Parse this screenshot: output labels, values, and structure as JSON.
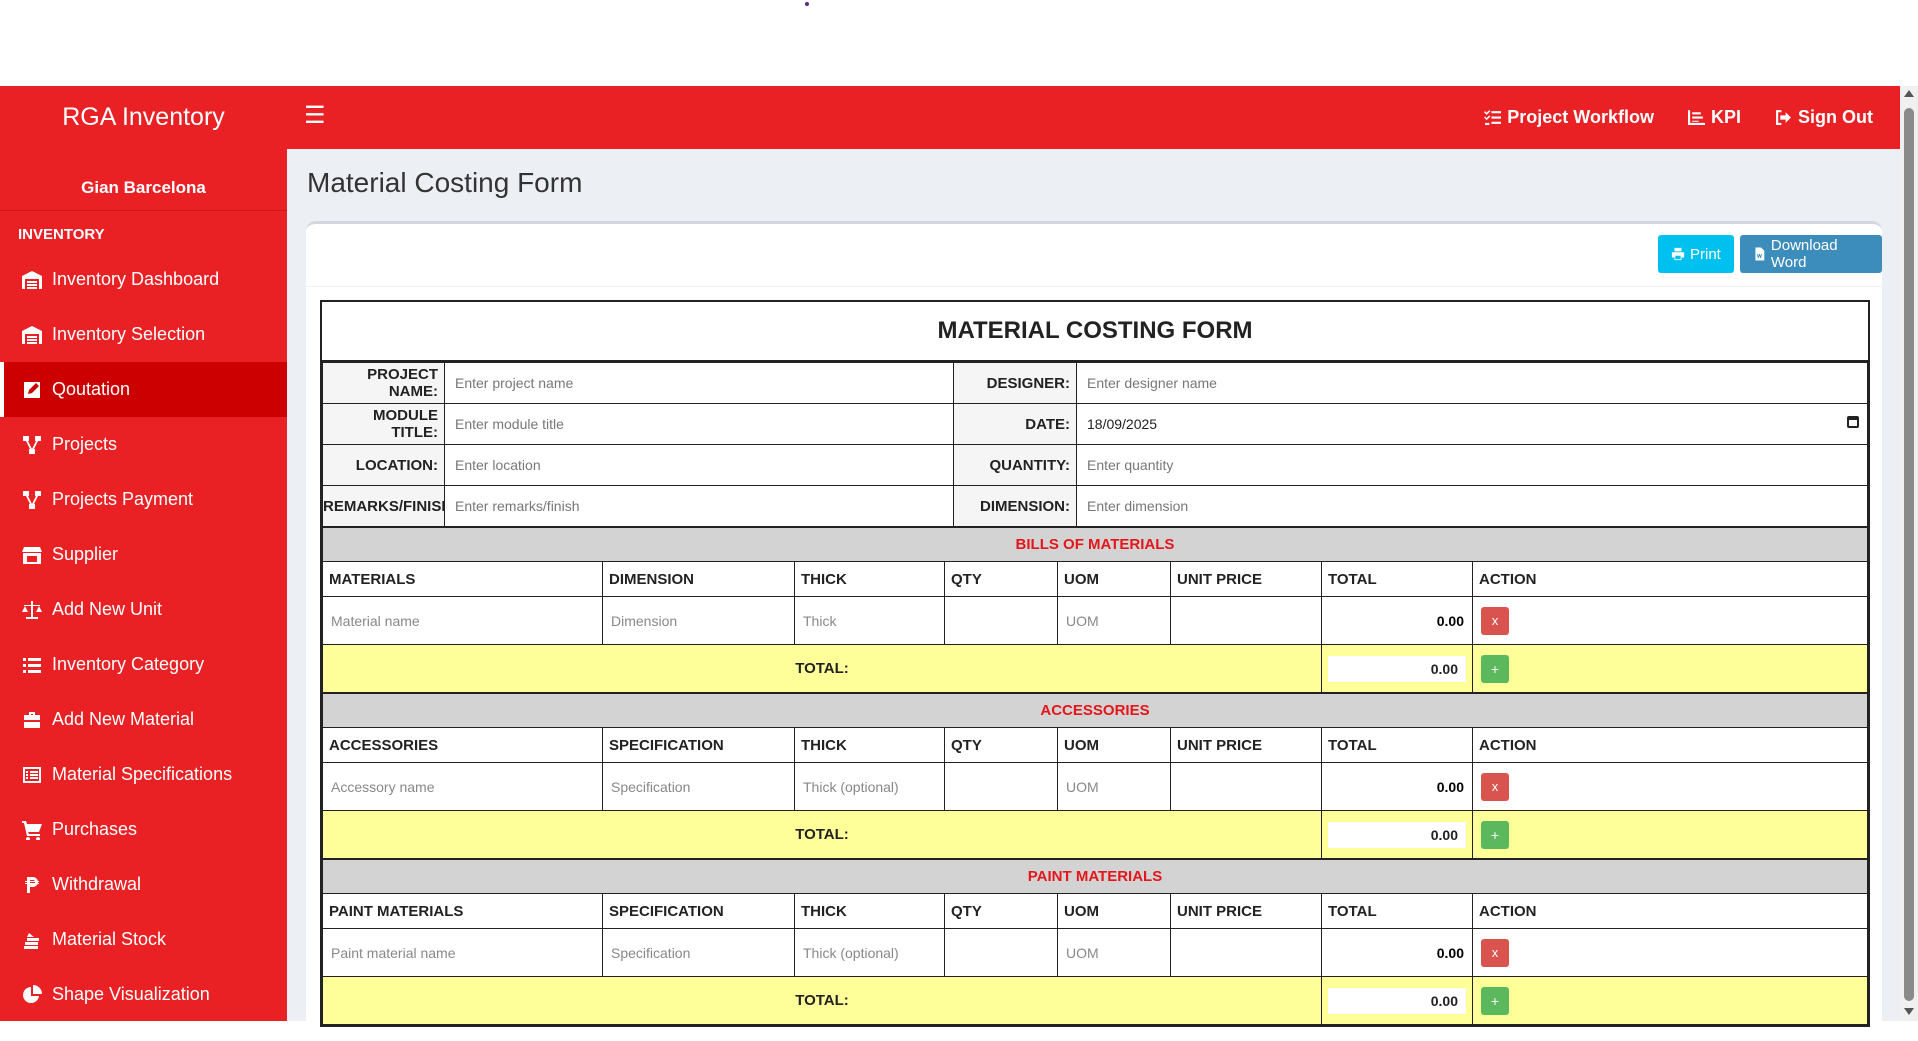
{
  "navbar": {
    "brand": "RGA Inventory",
    "links": [
      "Project Workflow",
      "KPI",
      "Sign Out"
    ]
  },
  "sidebar": {
    "username": "Gian Barcelona",
    "section": "INVENTORY",
    "items": [
      {
        "label": "Inventory Dashboard",
        "icon": "warehouse-icon"
      },
      {
        "label": "Inventory Selection",
        "icon": "warehouse-icon"
      },
      {
        "label": "Qoutation",
        "icon": "edit-icon"
      },
      {
        "label": "Projects",
        "icon": "project-diagram-icon"
      },
      {
        "label": "Projects Payment",
        "icon": "project-diagram-icon"
      },
      {
        "label": "Supplier",
        "icon": "store-icon"
      },
      {
        "label": "Add New Unit",
        "icon": "balance-scale-icon"
      },
      {
        "label": "Inventory Category",
        "icon": "list-icon"
      },
      {
        "label": "Add New Material",
        "icon": "toolbox-icon"
      },
      {
        "label": "Material Specifications",
        "icon": "list-alt-icon"
      },
      {
        "label": "Purchases",
        "icon": "cart-icon"
      },
      {
        "label": "Withdrawal",
        "icon": "peso-icon"
      },
      {
        "label": "Material Stock",
        "icon": "layer-stack-icon"
      },
      {
        "label": "Shape Visualization",
        "icon": "pie-chart-icon"
      }
    ],
    "active_index": 2
  },
  "page": {
    "title": "Material Costing Form",
    "print_label": "Print",
    "download_label": "Download Word"
  },
  "form": {
    "title": "MATERIAL COSTING FORM",
    "labels": {
      "project_name": "PROJECT NAME:",
      "designer": "DESIGNER:",
      "module_title": "MODULE TITLE:",
      "date": "DATE:",
      "location": "LOCATION:",
      "quantity": "QUANTITY:",
      "remarks": "REMARKS/FINISH:",
      "dimension": "DIMENSION:"
    },
    "placeholders": {
      "project_name": "Enter project name",
      "designer": "Enter designer name",
      "module_title": "Enter module title",
      "location": "Enter location",
      "quantity": "Enter quantity",
      "remarks": "Enter remarks/finish",
      "dimension": "Enter dimension"
    },
    "date_value": "18/09/2025"
  },
  "sections": {
    "bom": {
      "heading": "BILLS OF MATERIALS",
      "columns": [
        "MATERIALS",
        "DIMENSION",
        "THICK",
        "QTY",
        "UOM",
        "UNIT PRICE",
        "TOTAL",
        "ACTION"
      ],
      "placeholders": {
        "name": "Material name",
        "spec": "Dimension",
        "thick": "Thick",
        "uom": "UOM"
      },
      "row_total": "0.00",
      "total_label": "TOTAL:",
      "total_value": "0.00"
    },
    "acc": {
      "heading": "ACCESSORIES",
      "columns": [
        "ACCESSORIES",
        "SPECIFICATION",
        "THICK",
        "QTY",
        "UOM",
        "UNIT PRICE",
        "TOTAL",
        "ACTION"
      ],
      "placeholders": {
        "name": "Accessory name",
        "spec": "Specification",
        "thick": "Thick (optional)",
        "uom": "UOM"
      },
      "row_total": "0.00",
      "total_label": "TOTAL:",
      "total_value": "0.00"
    },
    "paint": {
      "heading": "PAINT MATERIALS",
      "columns": [
        "PAINT MATERIALS",
        "SPECIFICATION",
        "THICK",
        "QTY",
        "UOM",
        "UNIT PRICE",
        "TOTAL",
        "ACTION"
      ],
      "placeholders": {
        "name": "Paint material name",
        "spec": "Specification",
        "thick": "Thick (optional)",
        "uom": "UOM"
      },
      "row_total": "0.00",
      "total_label": "TOTAL:",
      "total_value": "0.00"
    }
  },
  "buttons": {
    "remove": "x",
    "add": "+"
  }
}
